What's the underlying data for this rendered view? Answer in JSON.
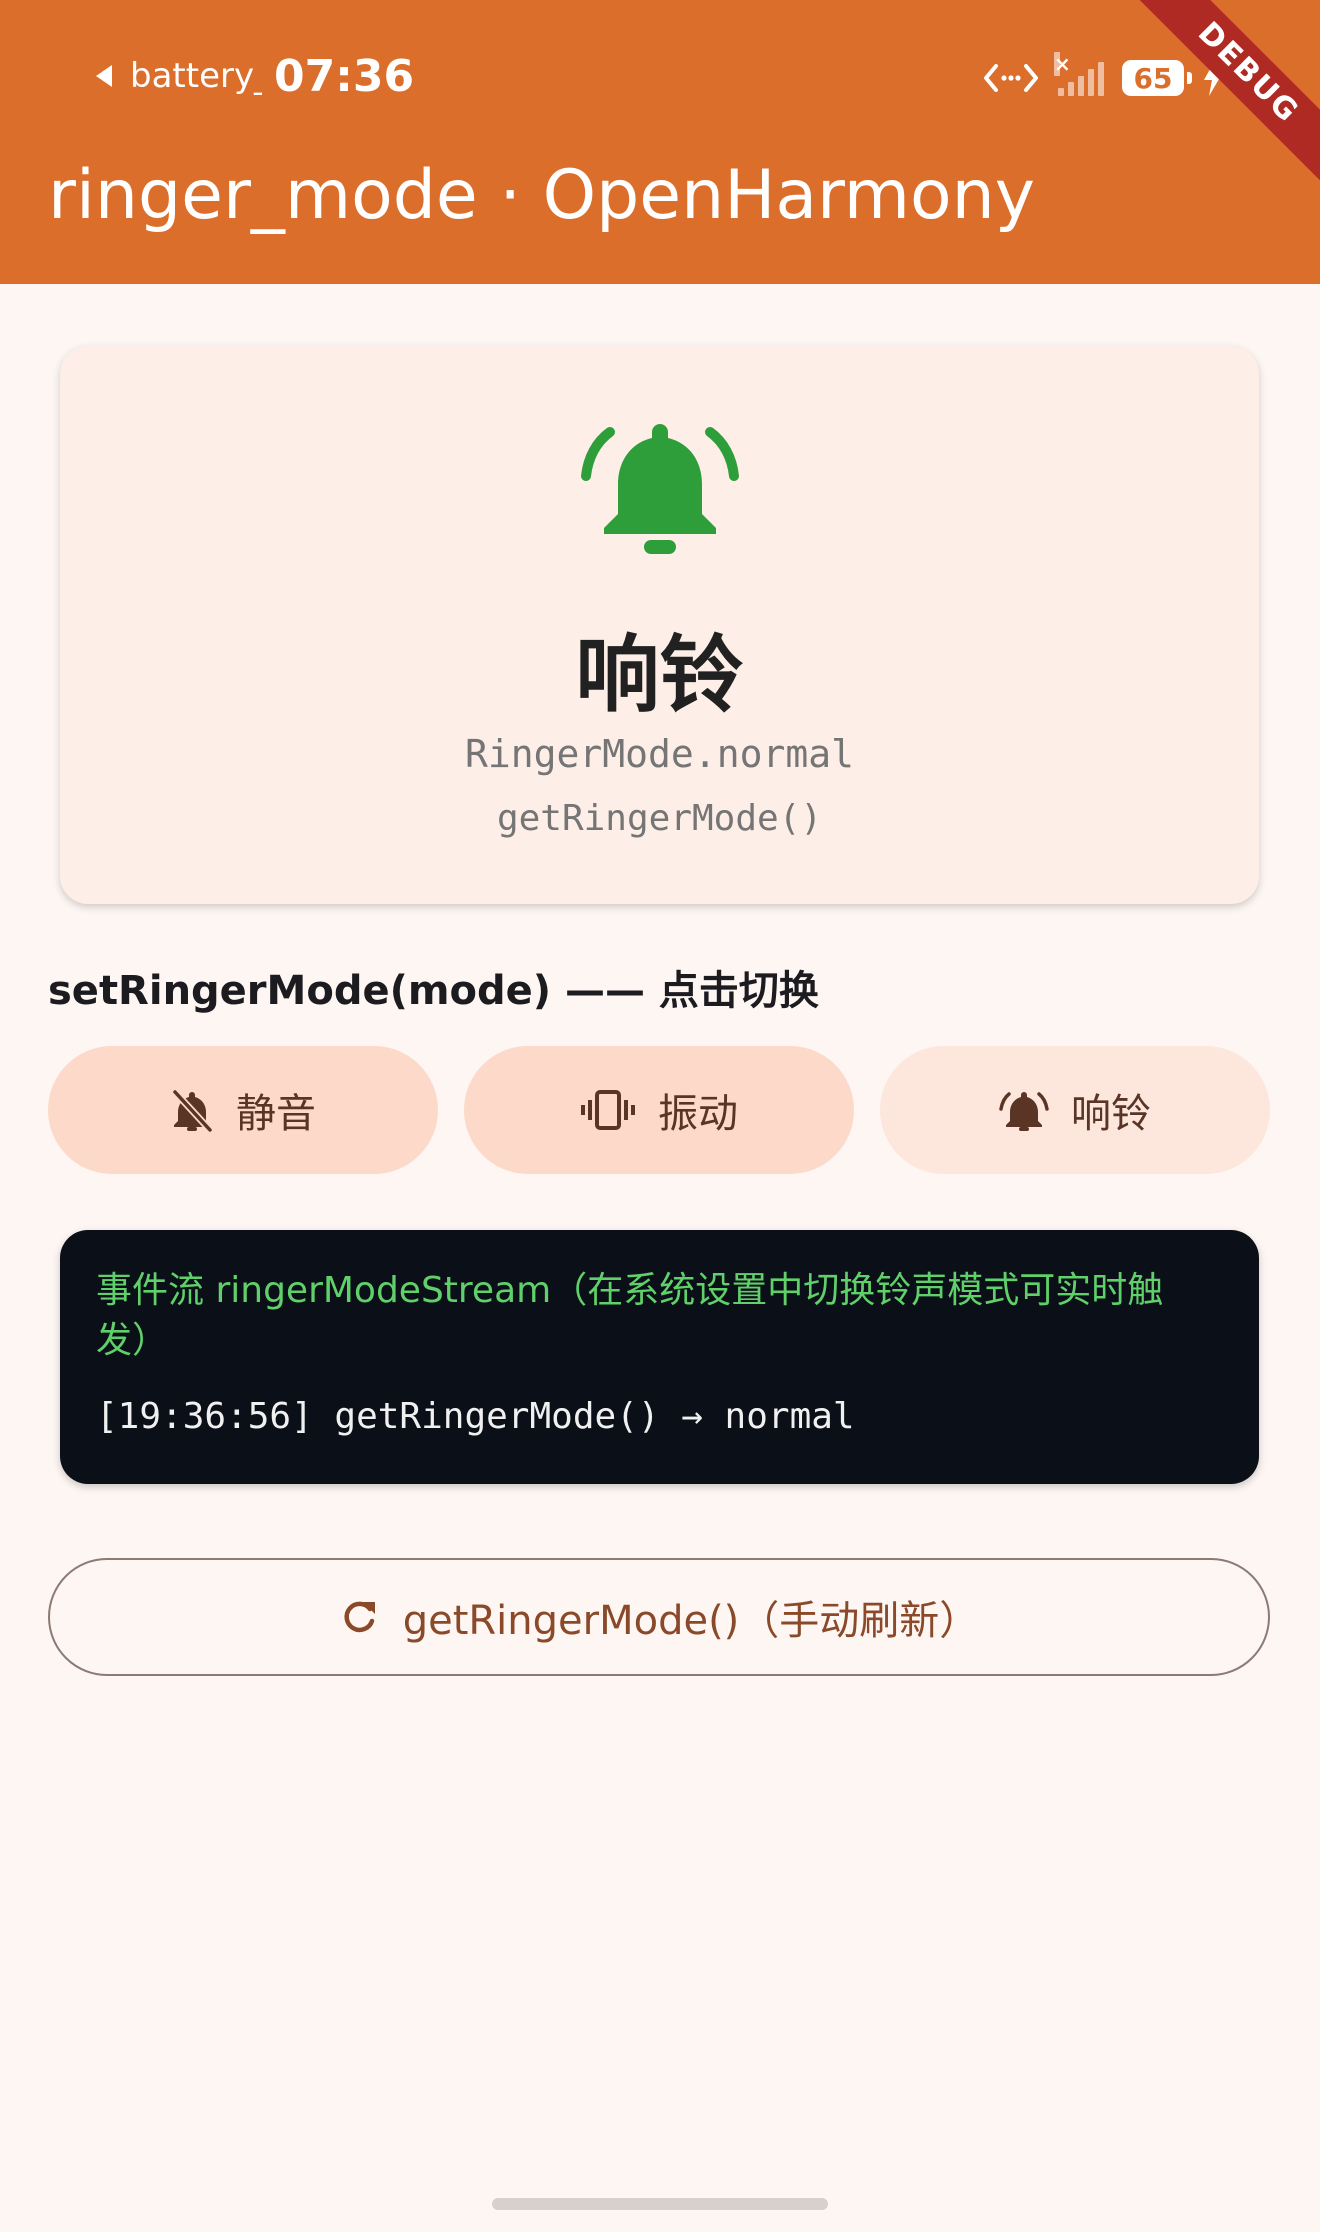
{
  "status_bar": {
    "app_label": "battery_",
    "time": "07:36",
    "battery_level": "65",
    "icons": [
      "back-triangle-icon",
      "code-arrows-icon",
      "signal-icon",
      "battery-icon",
      "charging-bolt-icon"
    ]
  },
  "debug_banner": "DEBUG",
  "app_bar": {
    "title": "ringer_mode · OpenHarmony",
    "color": "#dc6e2b"
  },
  "current_mode": {
    "icon": "bell-ringing-icon",
    "icon_color": "#2e9e3b",
    "title": "响铃",
    "enum": "RingerMode.normal",
    "api": "getRingerMode()"
  },
  "set_section": {
    "label": "setRingerMode(mode) —— 点击切换"
  },
  "mode_buttons": [
    {
      "icon": "bell-off-icon",
      "label": "静音"
    },
    {
      "icon": "vibrate-icon",
      "label": "振动"
    },
    {
      "icon": "bell-ringing-icon",
      "label": "响铃"
    }
  ],
  "event_log": {
    "header": "事件流 ringerModeStream（在系统设置中切换铃声模式可实时触发）",
    "header_color": "#5fd06a",
    "lines": [
      "[19:36:56] getRingerMode() → normal"
    ]
  },
  "refresh_button": {
    "icon": "refresh-icon",
    "label": "getRingerMode()（手动刷新）"
  }
}
